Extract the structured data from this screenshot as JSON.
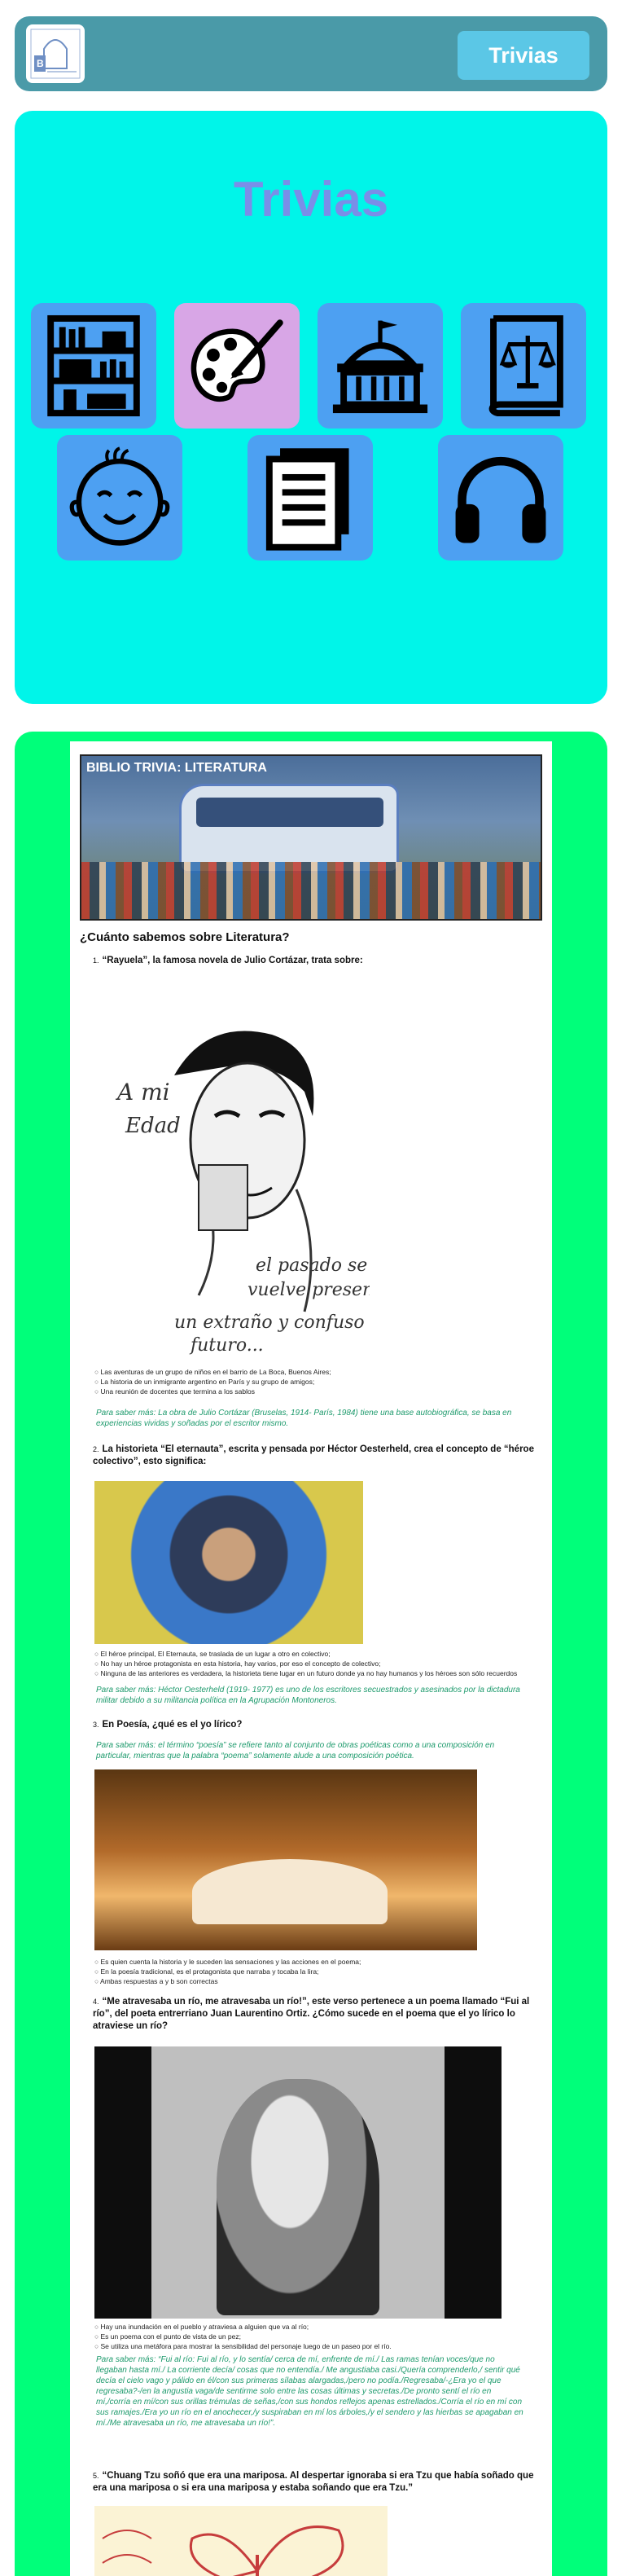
{
  "header": {
    "button_label": "Trivias",
    "logo_text": "Biblioteca BC Bariloche"
  },
  "trivias": {
    "title": "Trivias",
    "categories": [
      {
        "icon": "bookshelf-icon",
        "color": "#4da0f2"
      },
      {
        "icon": "palette-icon",
        "color": "#d8a6e6"
      },
      {
        "icon": "capitol-building-icon",
        "color": "#4da0f2"
      },
      {
        "icon": "law-book-icon",
        "color": "#4da0f2"
      },
      {
        "icon": "baby-face-icon",
        "color": "#4da0f2"
      },
      {
        "icon": "document-icon",
        "color": "#4da0f2"
      },
      {
        "icon": "headphones-icon",
        "color": "#4da0f2"
      }
    ]
  },
  "article": {
    "banner_title": "BIBLIO TRIVIA: LITERATURA",
    "heading": "¿Cuánto sabemos sobre Literatura?",
    "questions": [
      {
        "num": "1.",
        "text": "“Rayuela”, la famosa novela de Julio Cortázar, trata sobre:",
        "options": [
          "Las aventuras de un grupo de niños en el barrio de La Boca, Buenos Aires;",
          "La historia de un inmigrante argentino en París y su grupo de amigos;",
          "Una reunión de docentes que termina a los sablos"
        ],
        "note": "Para saber más: La obra de Julio Cortázar (Bruselas, 1914- París, 1984) tiene una base autobiográfica, se basa en experiencias vividas y soñadas por el escritor mismo."
      },
      {
        "num": "2.",
        "text": "La historieta “El eternauta”, escrita y pensada por Héctor Oesterheld, crea el concepto de “héroe colectivo”, esto significa:",
        "options": [
          "El héroe principal, El Eternauta, se traslada de un lugar a otro en colectivo;",
          "No hay un héroe protagonista en esta historia, hay varios, por eso el concepto de colectivo;",
          "Ninguna de las anteriores es verdadera, la historieta tiene lugar en un futuro donde ya no hay humanos y los héroes son sólo recuerdos"
        ],
        "note": "Para saber más: Héctor Oesterheld (1919- 1977) es uno de los escritores secuestrados y asesinados por la dictadura militar debido a su militancia política en la Agrupación Montoneros."
      },
      {
        "num": "3.",
        "text": "En Poesía, ¿qué es el yo lírico?",
        "note_top": "Para saber más: el término “poesía” se refiere tanto al conjunto de obras poéticas como a una composición en particular, mientras que la palabra “poema” solamente alude a una composición poética.",
        "options": [
          "Es quien cuenta la historia y le suceden las sensaciones y las acciones en el poema;",
          "En la poesía tradicional, es el protagonista que narraba y tocaba la lira;",
          "Ambas respuestas a y b son correctas"
        ]
      },
      {
        "num": "4.",
        "text": "“Me atravesaba un río, me atravesaba un río!”, este verso pertenece a un poema llamado “Fui al río”, del poeta entrerriano Juan Laurentino Ortiz. ¿Cómo sucede en el poema que el yo lírico lo atraviese un río?",
        "options": [
          "Hay una inundación en el pueblo y atraviesa a alguien que va al río;",
          "Es un poema con el punto de vista de un pez;",
          "Se utiliza una metáfora para mostrar la sensibilidad del personaje luego de un paseo por el río."
        ],
        "note": "Para saber más: “Fui al río: Fui al río, y lo sentía/ cerca de mí, enfrente de mí./ Las ramas tenían voces/que no llegaban hasta mí./ La corriente decía/ cosas que no entendía./ Me angustiaba casi./Quería comprenderlo,/ sentir qué decía el cielo vago y pálido en él/con sus primeras sílabas alargadas,/pero no podía./Regresaba/-¿Era yo el que regresaba?-/en la angustia vaga/de sentirme solo entre las cosas últimas y secretas./De pronto sentí el río en mí,/corría en mí/con sus orillas trémulas de señas,/con sus hondos reflejos apenas estrellados./Corría el río en mí con sus ramajes./Era yo un río en el anochecer,/y suspiraban en mí los árboles,/y el sendero y las hierbas se apagaban en mí./Me atravesaba un río, me atravesaba un río!”."
      },
      {
        "num": "5.",
        "text": "“Chuang Tzu soñó que era una mariposa. Al despertar ignoraba si era Tzu que había soñado que era una mariposa o si era una mariposa y estaba soñando que era Tzu.”"
      }
    ]
  }
}
